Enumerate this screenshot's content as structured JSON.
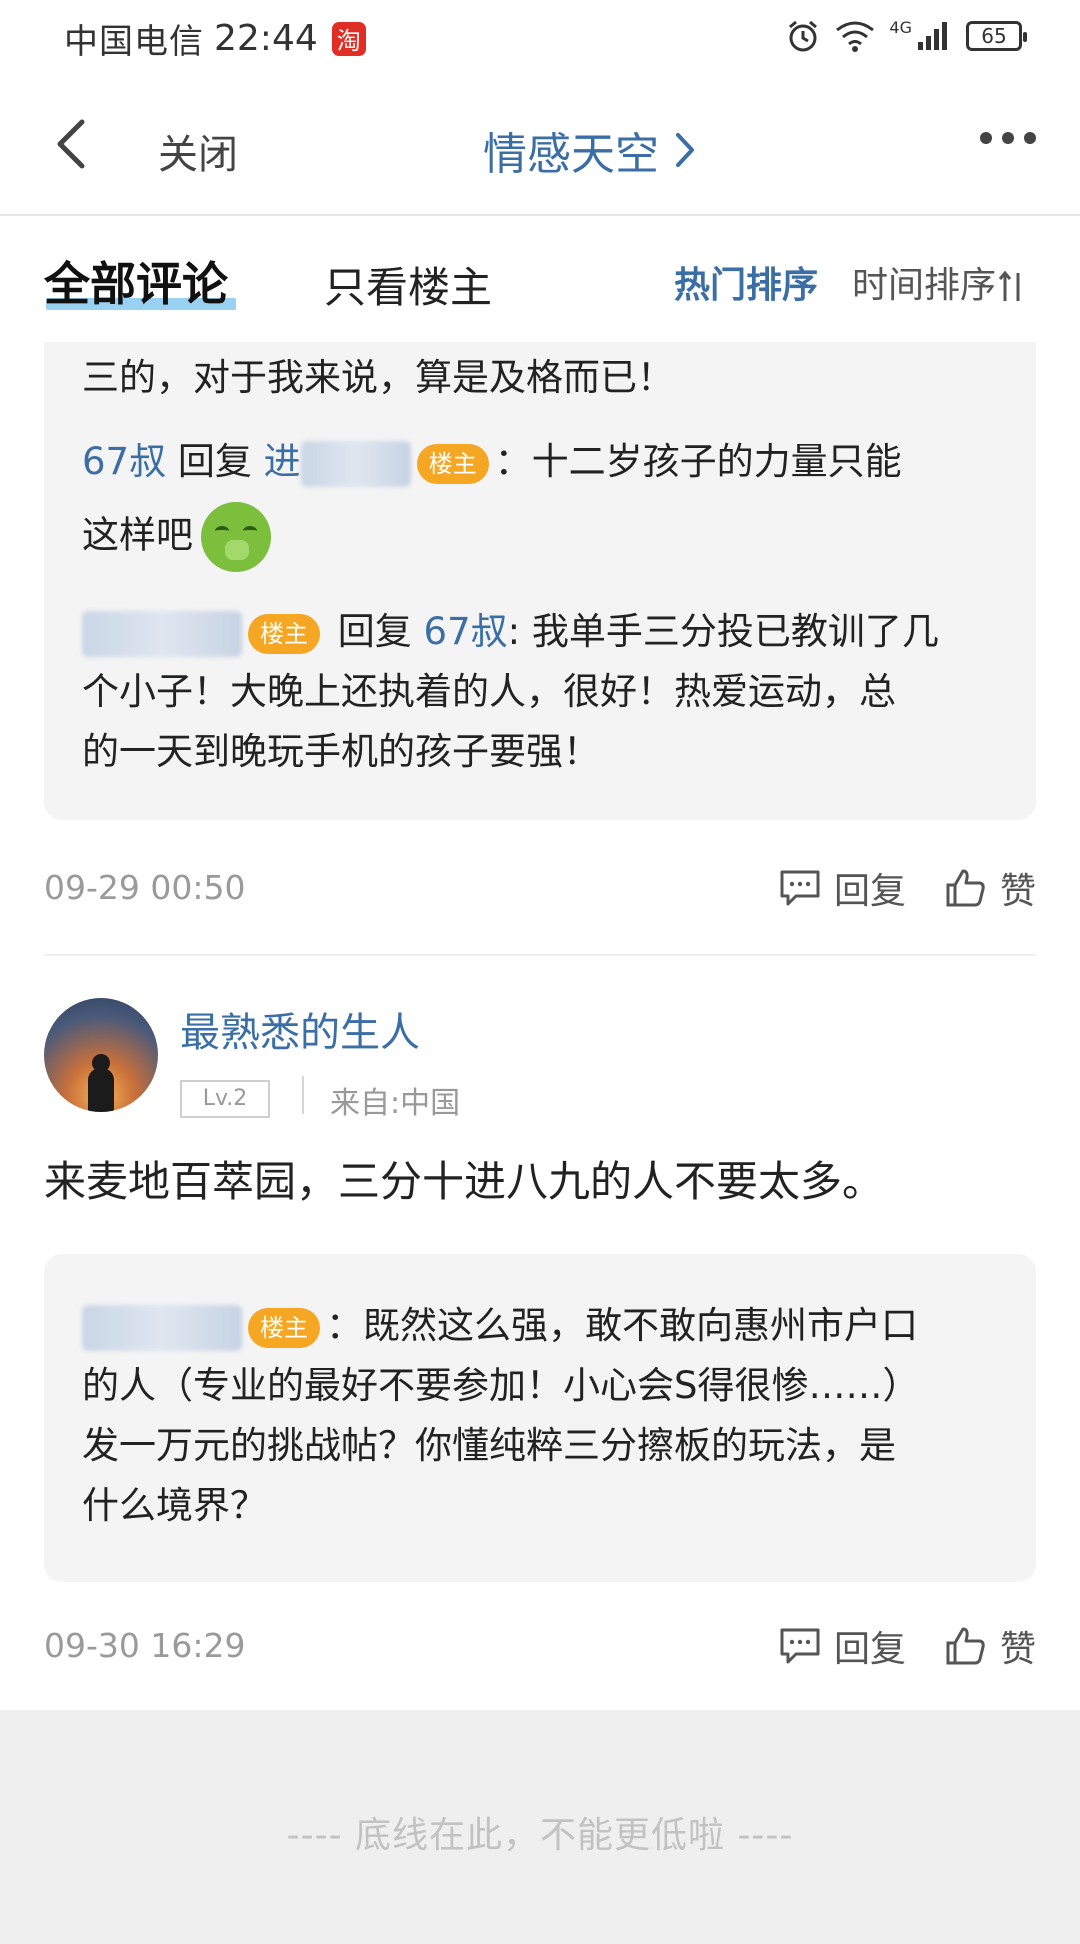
{
  "status_bar": {
    "carrier": "中国电信",
    "time": "22:44",
    "app_badge": "淘",
    "network": "4G",
    "battery": "65"
  },
  "nav": {
    "close": "关闭",
    "title": "情感天空"
  },
  "tabs": {
    "all": "全部评论",
    "op_only": "只看楼主",
    "sort_hot": "热门排序",
    "sort_time": "时间排序"
  },
  "thread1": {
    "line0": "三的，对于我来说，算是及格而已！",
    "reply1": {
      "author": "67叔",
      "verb": "回复",
      "target_visible": "进",
      "owner_tag": "楼主",
      "text_a": "：十二岁孩子的力量只能",
      "text_b": "这样吧"
    },
    "reply2": {
      "owner_tag": "楼主",
      "verb": "回复",
      "target": "67叔",
      "text_a": ": 我单手三分投已教训了几",
      "text_b": "个小子！大晚上还执着的人，很好！热爱运动，总",
      "text_c": "的一天到晚玩手机的孩子要强！"
    },
    "date": "09-29 00:50",
    "reply_label": "回复",
    "like_label": "赞"
  },
  "comment2": {
    "author": "最熟悉的生人",
    "level": "Lv.2",
    "from": "来自:中国",
    "text": "来麦地百萃园，三分十进八九的人不要太多。",
    "reply": {
      "owner_tag": "楼主",
      "text_a": "：既然这么强，敢不敢向惠州市户口",
      "text_b": "的人（专业的最好不要参加！小心会S得很惨……）",
      "text_c": "发一万元的挑战帖？你懂纯粹三分擦板的玩法，是",
      "text_d": "什么境界？"
    },
    "date": "09-30 16:29",
    "reply_label": "回复",
    "like_label": "赞"
  },
  "footer": {
    "text": "---- 底线在此，不能更低啦 ----"
  }
}
